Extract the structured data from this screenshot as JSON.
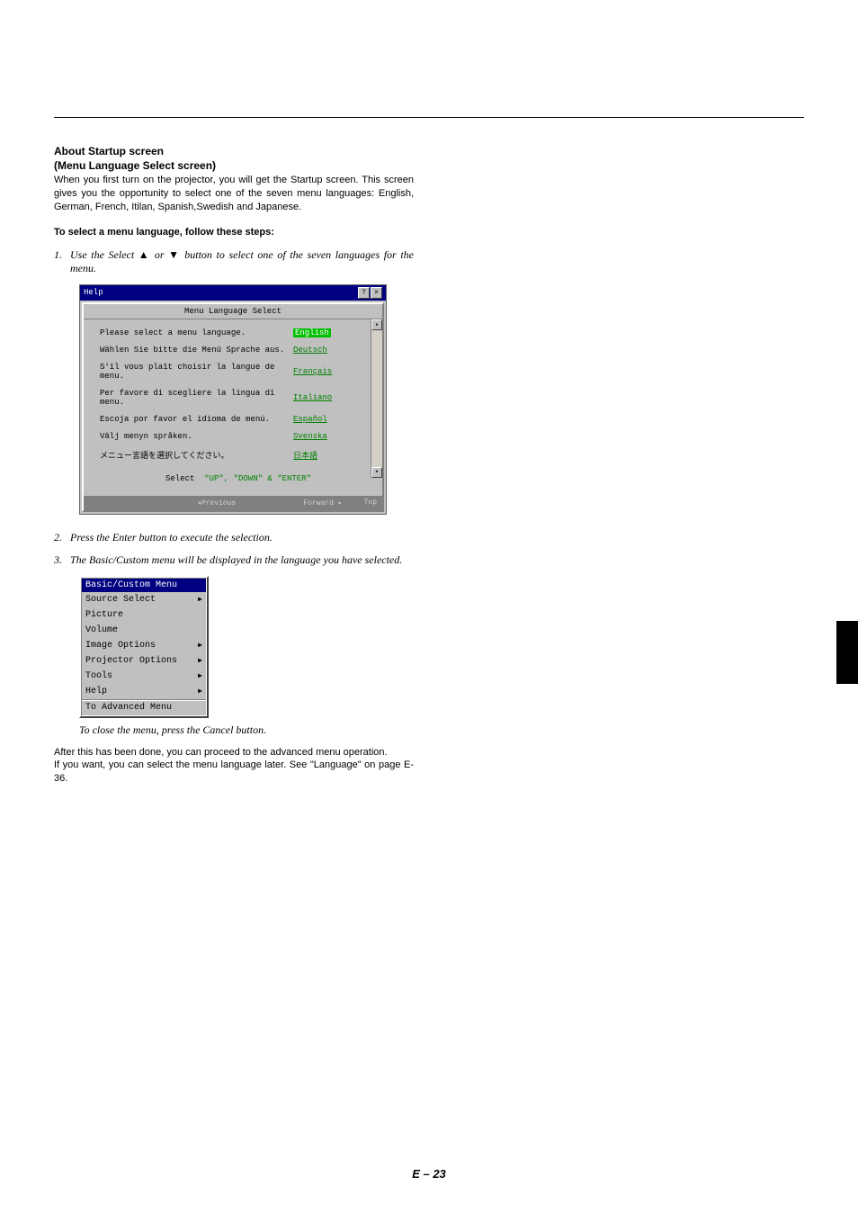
{
  "heading1": "About Startup screen",
  "heading2": "(Menu Language Select screen)",
  "intro": "When you first turn on the projector, you will get the Startup screen. This screen gives you the opportunity to select one of the seven menu languages: English, German, French, Itilan, Spanish,Swedish and Japanese.",
  "select_steps_heading": "To select a menu language, follow these steps:",
  "step1": {
    "num": "1.",
    "pre": "Use the Select ",
    "mid": " or ",
    "post": " button to select one of the seven languages for the menu."
  },
  "up_glyph": "▲",
  "down_glyph": "▼",
  "lang_window": {
    "title": "Help",
    "btn_help": "?",
    "btn_close": "×",
    "header": "Menu Language Select",
    "rows": [
      {
        "prompt": "Please select a menu language.",
        "opt": "English",
        "selected": true
      },
      {
        "prompt": "Wählen Sie bitte die Menü Sprache aus.",
        "opt": "Deutsch",
        "selected": false
      },
      {
        "prompt": "S'il vous plaît choisir la langue de menu.",
        "opt": "Français",
        "selected": false
      },
      {
        "prompt": "Per favore di scegliere la lingua di menu.",
        "opt": "Italiano",
        "selected": false
      },
      {
        "prompt": "Escoja por favor el idioma de menú.",
        "opt": "Español",
        "selected": false
      },
      {
        "prompt": "Välj menyn språken.",
        "opt": "Svenska",
        "selected": false
      },
      {
        "prompt": "メニュー言語を選択してください。",
        "opt": "日本語",
        "selected": false
      }
    ],
    "instr_label": "Select",
    "instr_keys": "\"UP\", \"DOWN\"  &  \"ENTER\"",
    "footer_prev": "◂Previous",
    "footer_fwd": "Forward ▸",
    "footer_top": "Top",
    "scroll_up": "▴",
    "scroll_down": "▾"
  },
  "step2": {
    "num": "2.",
    "text": "Press the Enter button to execute the selection."
  },
  "step3": {
    "num": "3.",
    "text": "The Basic/Custom menu will be displayed in the language you have selected."
  },
  "menu": {
    "title": "Basic/Custom Menu",
    "items": [
      {
        "label": "Source Select",
        "arrow": true
      },
      {
        "label": "Picture",
        "arrow": false
      },
      {
        "label": "Volume",
        "arrow": false
      },
      {
        "label": "Image Options",
        "arrow": true
      },
      {
        "label": "Projector Options",
        "arrow": true
      },
      {
        "label": "Tools",
        "arrow": true
      },
      {
        "label": "Help",
        "arrow": true
      }
    ],
    "advanced": "To Advanced Menu",
    "tri": "▶"
  },
  "close_note": "To close the menu, press the Cancel button.",
  "after1": "After this has been done, you can proceed to the advanced menu operation.",
  "after2": "If you want, you can select the menu language later. See \"Language\" on page E-36.",
  "page_num": "E – 23"
}
